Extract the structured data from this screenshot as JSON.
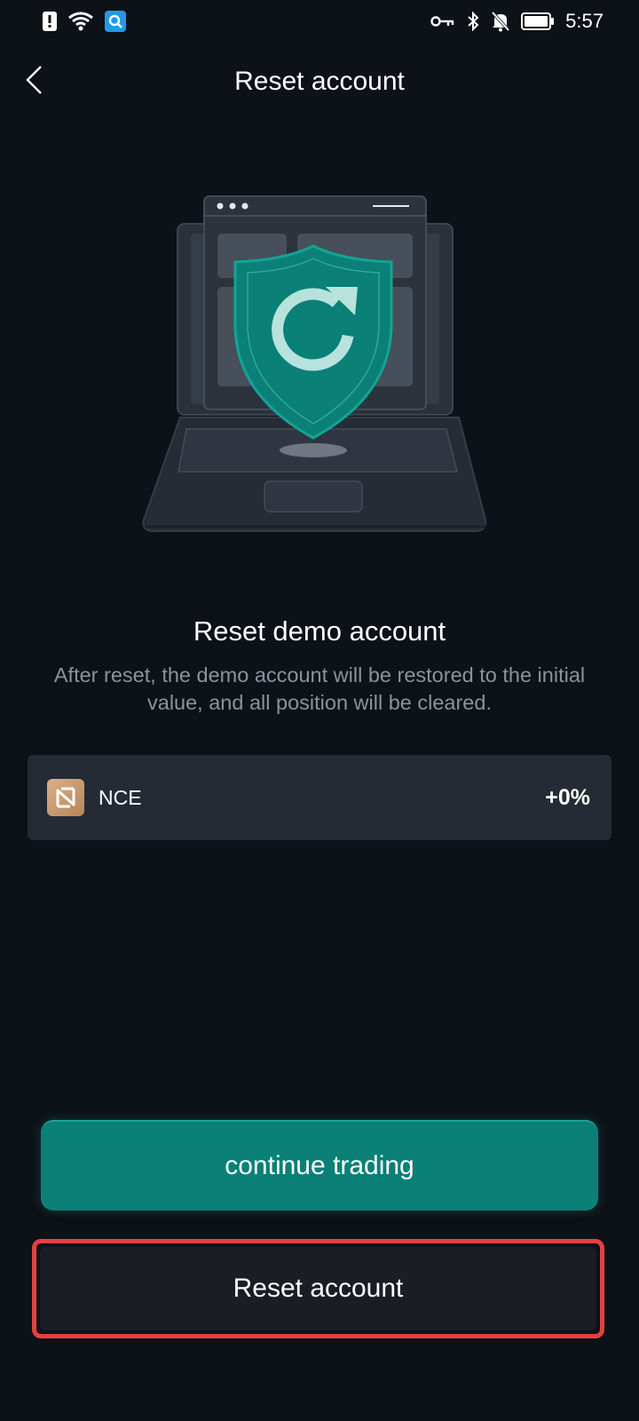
{
  "status_bar": {
    "time": "5:57",
    "icons": [
      "alert-icon",
      "wifi-icon",
      "search-app-icon",
      "key-icon",
      "bluetooth-icon",
      "notifications-off-icon",
      "battery-icon"
    ]
  },
  "header": {
    "title": "Reset account",
    "back_icon": "chevron-left-icon"
  },
  "illustration": {
    "name": "laptop-shield-reset-illustration",
    "accent_color": "#0a8077"
  },
  "content": {
    "title": "Reset demo account",
    "description": "After reset, the demo account will be restored to the initial value, and all position will be cleared."
  },
  "account": {
    "name": "NCE",
    "change": "+0%",
    "logo_icon": "nce-logo-icon"
  },
  "actions": {
    "continue_label": "continue trading",
    "reset_label": "Reset account"
  },
  "colors": {
    "background": "#0d1118",
    "card": "#252b35",
    "primary": "#0a8077",
    "highlight_border": "#e5403f"
  }
}
